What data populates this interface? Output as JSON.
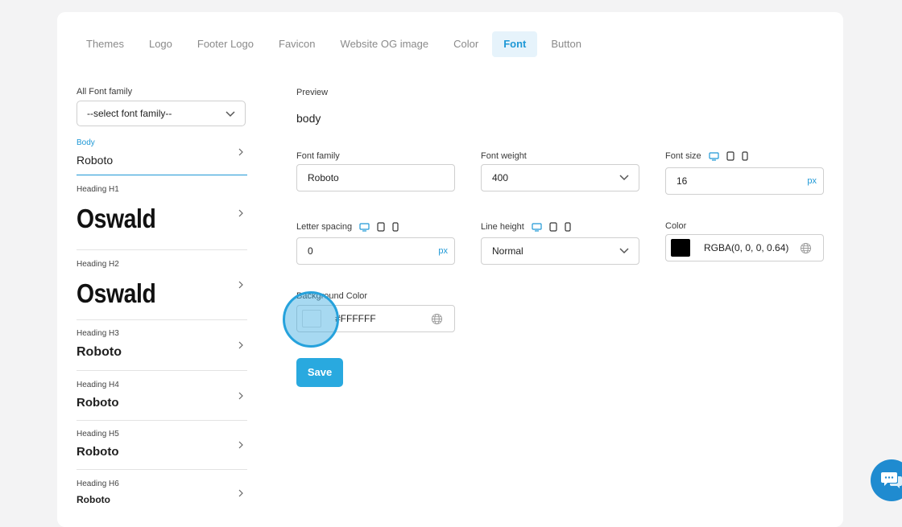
{
  "tabs": [
    {
      "label": "Themes"
    },
    {
      "label": "Logo"
    },
    {
      "label": "Footer Logo"
    },
    {
      "label": "Favicon"
    },
    {
      "label": "Website OG image"
    },
    {
      "label": "Color"
    },
    {
      "label": "Font",
      "active": true
    },
    {
      "label": "Button"
    }
  ],
  "sidebar": {
    "all_font_family_label": "All Font family",
    "select_placeholder": "--select font family--",
    "items": [
      {
        "label": "Body",
        "font": "Roboto"
      },
      {
        "label": "Heading H1",
        "font": "Oswald"
      },
      {
        "label": "Heading H2",
        "font": "Oswald"
      },
      {
        "label": "Heading H3",
        "font": "Roboto"
      },
      {
        "label": "Heading H4",
        "font": "Roboto"
      },
      {
        "label": "Heading H5",
        "font": "Roboto"
      },
      {
        "label": "Heading H6",
        "font": "Roboto"
      }
    ]
  },
  "form": {
    "preview_label": "Preview",
    "preview_text": "body",
    "font_family_label": "Font family",
    "font_family_value": "Roboto",
    "font_weight_label": "Font weight",
    "font_weight_value": "400",
    "font_size_label": "Font size",
    "font_size_value": "16",
    "unit_px": "px",
    "letter_spacing_label": "Letter spacing",
    "letter_spacing_value": "0",
    "line_height_label": "Line height",
    "line_height_value": "Normal",
    "color_label": "Color",
    "color_value": "RGBA(0, 0, 0, 0.64)",
    "bg_color_label": "Background Color",
    "bg_color_value": "#FFFFFF",
    "save_label": "Save"
  },
  "colors": {
    "accent": "#1e98d6",
    "save_button": "#29a9df",
    "color_swatch": "#000000",
    "bg_swatch": "#ffffff",
    "chat_button": "#1f8bd0"
  }
}
